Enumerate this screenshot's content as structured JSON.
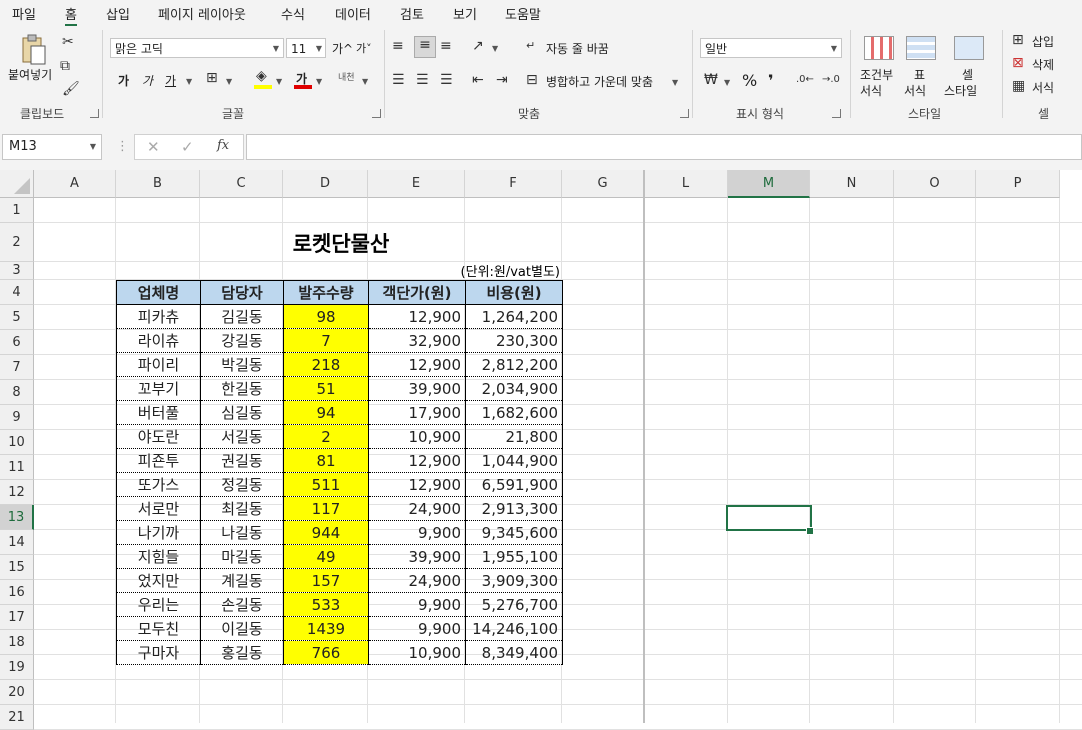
{
  "menu": [
    "파일",
    "홈",
    "삽입",
    "페이지 레이아웃",
    "수식",
    "데이터",
    "검토",
    "보기",
    "도움말"
  ],
  "ribbon": {
    "clipboard": {
      "title": "클립보드",
      "paste": "붙여넣기"
    },
    "font": {
      "title": "글꼴",
      "name": "맑은 고딕",
      "size": "11",
      "grow": "가^",
      "shrink": "가˅",
      "bold": "가",
      "italic": "가",
      "underline": "가",
      "font_color_glyph": "가",
      "phonetic": "내천"
    },
    "align": {
      "title": "맞춤",
      "wrap": "자동 줄 바꿈",
      "merge": "병합하고 가운데 맞춤"
    },
    "number": {
      "title": "표시 형식",
      "format": "일반",
      "percent": "%",
      "comma": "❜"
    },
    "styles": {
      "title": "스타일",
      "cond1": "조건부",
      "cond2": "서식",
      "table1": "표",
      "table2": "서식",
      "cell1": "셀",
      "cell2": "스타일"
    },
    "cells": {
      "title": "셀",
      "insert": "삽입",
      "delete": "삭제",
      "format": "서식"
    }
  },
  "formula_bar": {
    "name_box": "M13",
    "fx": "fx",
    "value": ""
  },
  "columns": [
    "A",
    "B",
    "C",
    "D",
    "E",
    "F",
    "G",
    "L",
    "M",
    "N",
    "O",
    "P"
  ],
  "rows": [
    "1",
    "2",
    "3",
    "4",
    "5",
    "6",
    "7",
    "8",
    "9",
    "10",
    "11",
    "12",
    "13",
    "14",
    "15",
    "16",
    "17",
    "18",
    "19",
    "20",
    "21"
  ],
  "sheet": {
    "title": "로켓단물산",
    "unit": "(단위:원/vat별도)",
    "headers": [
      "업체명",
      "담당자",
      "발주수량",
      "객단가(원)",
      "비용(원)"
    ],
    "data": [
      [
        "피카츄",
        "김길동",
        "98",
        "12,900",
        "1,264,200"
      ],
      [
        "라이츄",
        "강길동",
        "7",
        "32,900",
        "230,300"
      ],
      [
        "파이리",
        "박길동",
        "218",
        "12,900",
        "2,812,200"
      ],
      [
        "꼬부기",
        "한길동",
        "51",
        "39,900",
        "2,034,900"
      ],
      [
        "버터풀",
        "심길동",
        "94",
        "17,900",
        "1,682,600"
      ],
      [
        "야도란",
        "서길동",
        "2",
        "10,900",
        "21,800"
      ],
      [
        "피죤투",
        "권길동",
        "81",
        "12,900",
        "1,044,900"
      ],
      [
        "또가스",
        "정길동",
        "511",
        "12,900",
        "6,591,900"
      ],
      [
        "서로만",
        "최길동",
        "117",
        "24,900",
        "2,913,300"
      ],
      [
        "나기까",
        "나길동",
        "944",
        "9,900",
        "9,345,600"
      ],
      [
        "지힘들",
        "마길동",
        "49",
        "39,900",
        "1,955,100"
      ],
      [
        "었지만",
        "계길동",
        "157",
        "24,900",
        "3,909,300"
      ],
      [
        "우리는",
        "손길동",
        "533",
        "9,900",
        "5,276,700"
      ],
      [
        "모두친",
        "이길동",
        "1439",
        "9,900",
        "14,246,100"
      ],
      [
        "구마자",
        "홍길동",
        "766",
        "10,900",
        "8,349,400"
      ]
    ]
  }
}
